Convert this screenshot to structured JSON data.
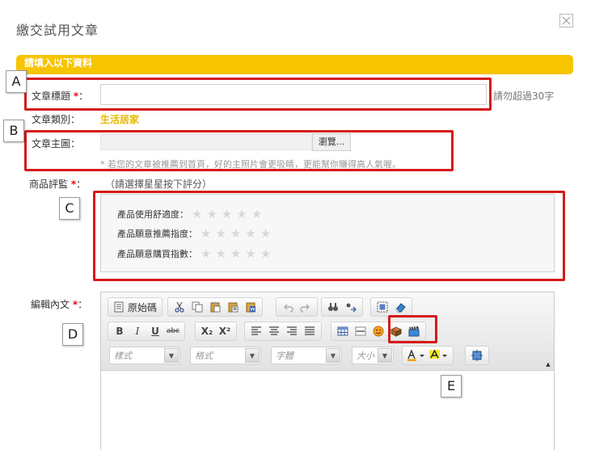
{
  "dialog": {
    "title": "繳交試用文章"
  },
  "section": {
    "header": "請填入以下資料"
  },
  "form": {
    "title_label": "文章標題",
    "required_mark": "*",
    "colon": "：",
    "title_value": "",
    "title_hint": "請勿超過30字",
    "category_label": "文章類別：",
    "category_value": "生活居家",
    "image_label": "文章主圖：",
    "image_file_value": "",
    "browse_label": "瀏覽...",
    "image_note": "* 若您的文章被推薦到首頁，好的主照片會更吸睛，更能幫你賺得高人氣喔。",
    "rating_label": "商品評監",
    "rating_hint": "（請選擇星星按下評分）",
    "ratings": [
      {
        "label": "產品使用舒適度：",
        "stars": 0,
        "max": 5
      },
      {
        "label": "產品願意推薦指度：",
        "stars": 0,
        "max": 5
      },
      {
        "label": "產品願意購買指數：",
        "stars": 0,
        "max": 5
      }
    ],
    "content_label": "編輯內文"
  },
  "editor": {
    "source_label": "原始碼",
    "style_combo": "樣式",
    "format_combo": "格式",
    "font_combo": "字體",
    "size_combo": "大小",
    "bold": "B",
    "italic": "I",
    "underline": "U",
    "strike": "abc",
    "subscript": "X₂",
    "superscript": "X²"
  },
  "annotations": [
    "A",
    "B",
    "C",
    "D",
    "E"
  ],
  "colors": {
    "accent": "#f7c400",
    "annotation": "#d51a1a",
    "category": "#e6b800",
    "required": "#ee0000"
  }
}
